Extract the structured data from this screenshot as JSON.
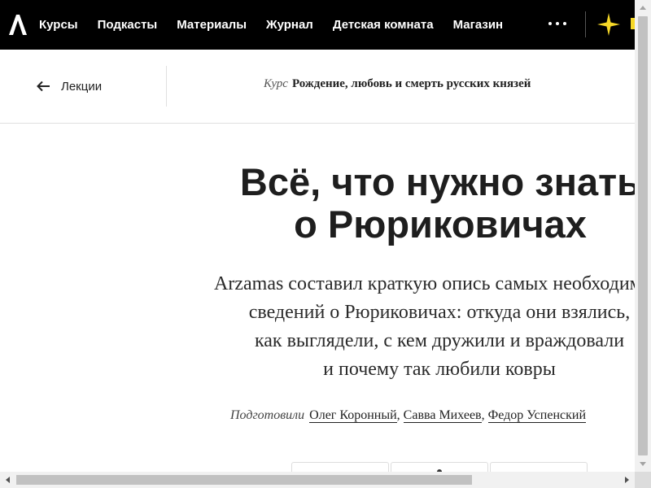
{
  "nav": {
    "logo_icon": "arzamas-logo-icon",
    "items": [
      {
        "label": "Курсы"
      },
      {
        "label": "Подкасты"
      },
      {
        "label": "Материалы"
      },
      {
        "label": "Журнал"
      },
      {
        "label": "Детская комната"
      },
      {
        "label": "Магазин"
      }
    ],
    "more_icon": "more-dots-icon",
    "promo_icon": "sparkle-icon",
    "accent_color": "#f6d827"
  },
  "subheader": {
    "back_label": "Лекции",
    "course_kind": "Курс",
    "course_name": "Рождение, любовь и смерть русских князей"
  },
  "article": {
    "title_line1": "Всё, что нужно знать",
    "title_line2": "о Рюриковичах",
    "lead_lines": [
      "Arzamas составил краткую опись самых необходимых",
      "сведений о Рюриковичах: откуда они взялись,",
      "как выглядели, с кем дружили и враждовали",
      "и почему так любили ковры"
    ],
    "authors_label": "Подготовили",
    "authors": [
      "Олег Коронный",
      "Савва Михеев",
      "Федор Успенский"
    ],
    "author_separator": ","
  }
}
